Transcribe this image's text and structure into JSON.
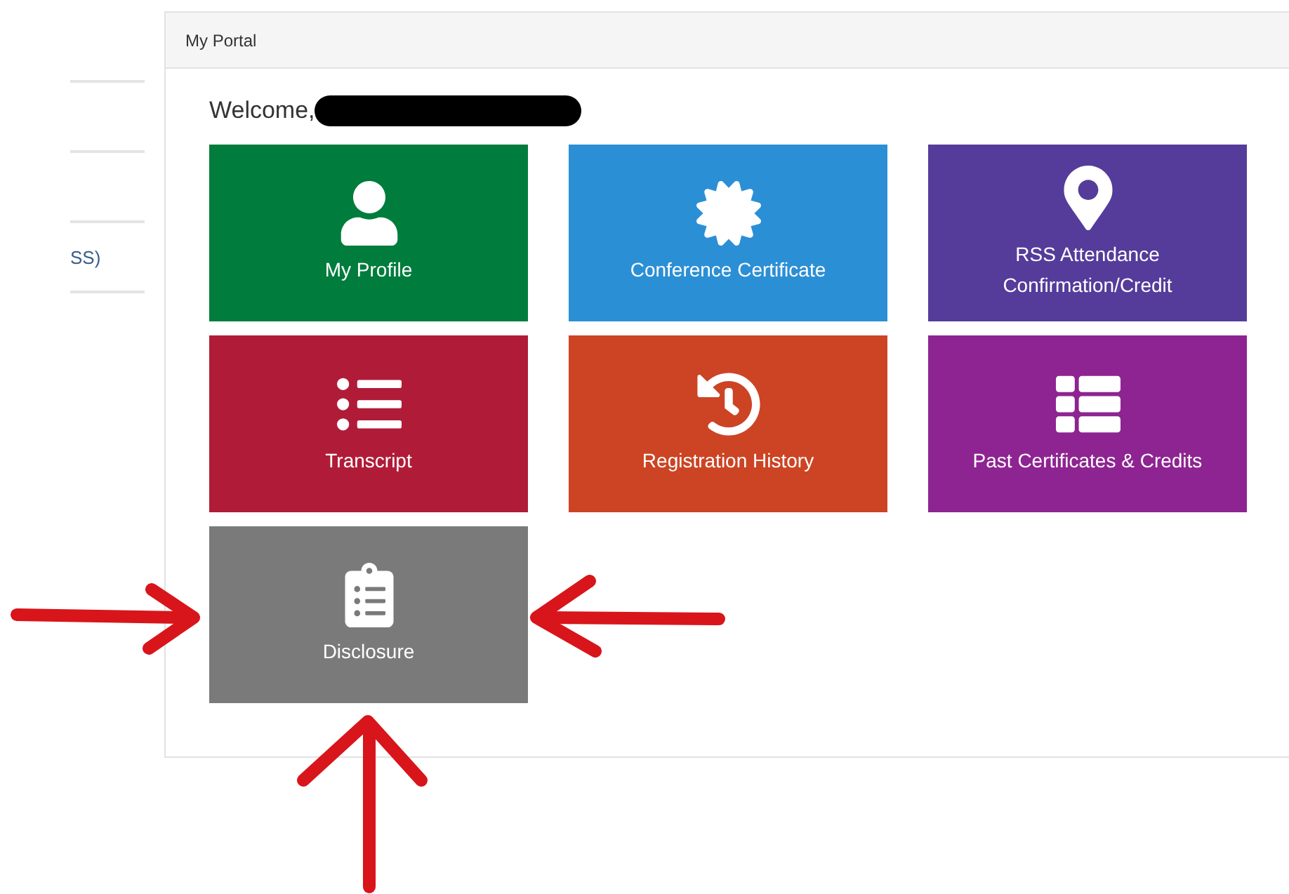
{
  "sidebar": {
    "items": [
      {
        "label": "SS)"
      }
    ]
  },
  "panel": {
    "title": "My Portal",
    "welcome": "Welcome,",
    "name_redacted": true
  },
  "tiles": [
    {
      "label": "My Profile",
      "kind": "person",
      "color": "#007c3c"
    },
    {
      "label": "Conference Certificate",
      "kind": "certificate",
      "color": "#2b8fd6"
    },
    {
      "label": "RSS Attendance Confirmation/Credit",
      "kind": "pin",
      "color": "#553c9a"
    },
    {
      "label": "Transcript",
      "kind": "list",
      "color": "#b01c38"
    },
    {
      "label": "Registration History",
      "kind": "history",
      "color": "#cc4424"
    },
    {
      "label": "Past Certificates & Credits",
      "kind": "table-list",
      "color": "#8e2491"
    },
    {
      "label": "Disclosure",
      "kind": "clipboard",
      "color": "#7a7a7a"
    }
  ],
  "annotations": [
    {
      "kind": "arrow-right"
    },
    {
      "kind": "arrow-left"
    },
    {
      "kind": "arrow-up"
    }
  ]
}
